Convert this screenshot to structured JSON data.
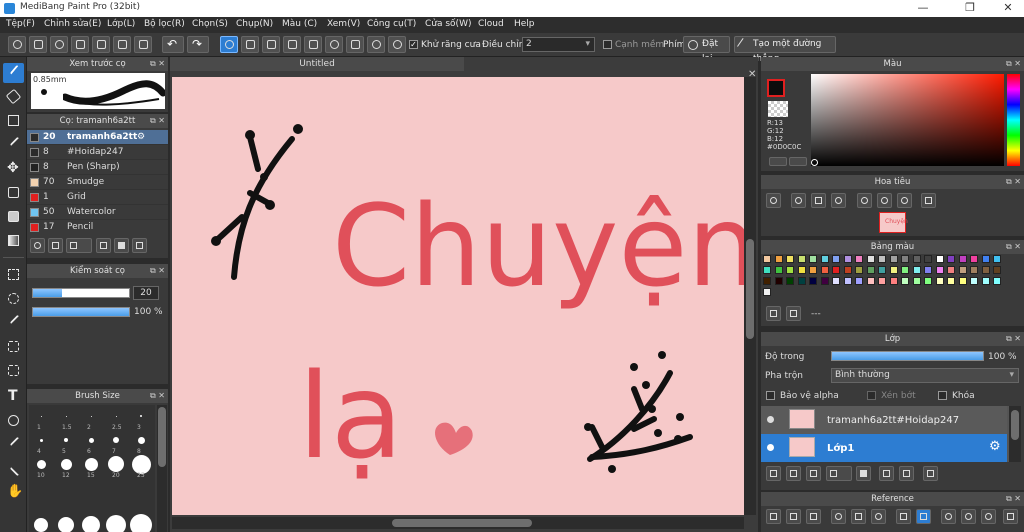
{
  "window": {
    "title": "MediBang Paint Pro (32bit)",
    "minimize": "—",
    "restore": "❐",
    "close": "✕"
  },
  "menu": [
    "Tệp(F)",
    "Chỉnh sửa(E)",
    "Lớp(L)",
    "Bộ lọc(R)",
    "Chọn(S)",
    "Chụp(N)",
    "Màu (C)",
    "Xem(V)",
    "Công cụ(T)",
    "Cửa số(W)",
    "Cloud",
    "Help"
  ],
  "toolbar": {
    "antialias_label": "Khử răng cưa",
    "adjust_label": "Điều chỉnh",
    "adjust_value": "2",
    "sharp_label": "Cạnh mềm",
    "pen_label": "Phím",
    "reset_label": "Đặt lại",
    "straight_line_label": "Tạo một đường thẳng"
  },
  "brush_preview": {
    "title": "Xem trước cọ",
    "size_label": "0.85mm"
  },
  "brush_panel": {
    "title": "Cọ: tramanh6a2tt",
    "items": [
      {
        "size": "20",
        "name": "tramanh6a2tt",
        "color": "#2b2b2b",
        "selected": true
      },
      {
        "size": "8",
        "name": "#Hoidap247",
        "color": "#2b2b2b",
        "selected": false
      },
      {
        "size": "8",
        "name": "Pen (Sharp)",
        "color": "#222222",
        "selected": false
      },
      {
        "size": "70",
        "name": "Smudge",
        "color": "#f2d2b0",
        "selected": false
      },
      {
        "size": "1",
        "name": "Grid",
        "color": "#e02020",
        "selected": false
      },
      {
        "size": "50",
        "name": "Watercolor",
        "color": "#6fc4f0",
        "selected": false
      },
      {
        "size": "17",
        "name": "Pencil",
        "color": "#e02020",
        "selected": false
      }
    ]
  },
  "brush_control": {
    "title": "Kiểm soát cọ",
    "size_value": "20",
    "size_fraction": 0.3,
    "opacity_value": "100 %",
    "opacity_fraction": 1.0
  },
  "brush_size": {
    "title": "Brush Size",
    "labels": [
      "1",
      "1.5",
      "2",
      "2.5",
      "3",
      "4",
      "5",
      "6",
      "7",
      "8",
      "10",
      "12",
      "15",
      "20",
      "25"
    ]
  },
  "canvas": {
    "tab_title": "Untitled",
    "background": "#f6c9c9",
    "text_main": "Chuyện",
    "text_second": "lạ",
    "ink_color": "#e0505a",
    "heart_color": "#e6707a"
  },
  "color_panel": {
    "title": "Màu",
    "r": "R:13",
    "g": "G:12",
    "b": "B:12",
    "hex": "#0D0C0C"
  },
  "navigator": {
    "title": "Hoa tiêu"
  },
  "palette": {
    "title": "Bảng màu",
    "count_label": "---"
  },
  "layer_panel": {
    "title": "Lớp",
    "opacity_label": "Độ trong",
    "opacity_value": "100 %",
    "opacity_fraction": 1.0,
    "blend_label": "Pha trộn",
    "blend_value": "Bình thường",
    "protect_alpha": "Bảo vệ alpha",
    "clipping": "Xén bớt",
    "lock": "Khóa",
    "layers": [
      {
        "name": "tramanh6a2tt#Hoidap247",
        "selected": false
      },
      {
        "name": "Lớp1",
        "selected": true
      }
    ]
  },
  "reference": {
    "title": "Reference"
  },
  "colors": {
    "accent": "#2d7dd2",
    "panel": "#3a3a3a",
    "header": "#4a4a4a"
  }
}
